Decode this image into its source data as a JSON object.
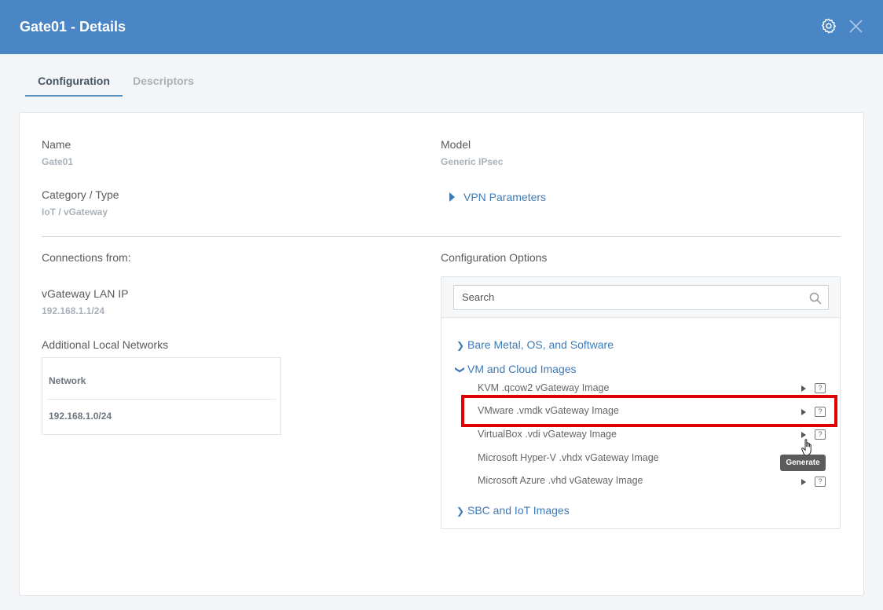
{
  "header": {
    "title": "Gate01 - Details"
  },
  "tabs": [
    {
      "label": "Configuration",
      "active": true
    },
    {
      "label": "Descriptors",
      "active": false
    }
  ],
  "details": {
    "name_label": "Name",
    "name_value": "Gate01",
    "model_label": "Model",
    "model_value": "Generic IPsec",
    "category_label": "Category / Type",
    "category_value": "IoT / vGateway",
    "vpn_link": "VPN Parameters"
  },
  "connections": {
    "label": "Connections from:",
    "lan_ip_label": "vGateway LAN IP",
    "lan_ip_value": "192.168.1.1/24",
    "additional_label": "Additional Local Networks",
    "table_header": "Network",
    "table_rows": [
      "192.168.1.0/24"
    ]
  },
  "config_options": {
    "label": "Configuration Options",
    "search_placeholder": "Search",
    "categories": [
      {
        "label": "Bare Metal, OS, and Software",
        "expanded": false
      },
      {
        "label": "VM and Cloud Images",
        "expanded": true,
        "items": [
          "KVM .qcow2 vGateway Image",
          "VMware .vmdk vGateway Image",
          "VirtualBox .vdi vGateway Image",
          "Microsoft Hyper-V .vhdx vGateway Image",
          "Microsoft Azure .vhd vGateway Image"
        ]
      },
      {
        "label": "SBC and IoT Images",
        "expanded": false
      }
    ],
    "help_glyph": "?",
    "tooltip": "Generate"
  },
  "colors": {
    "header_bg": "#4a86c6",
    "link": "#3d7ab8",
    "highlight": "#e00000"
  }
}
